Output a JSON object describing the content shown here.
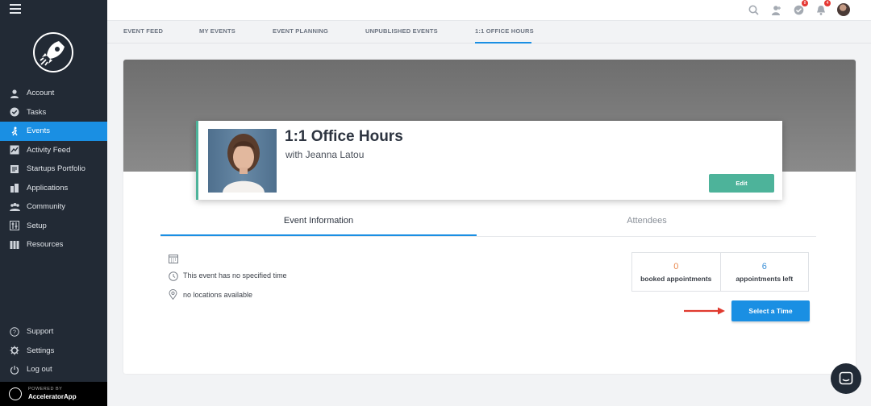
{
  "sidebar": {
    "items": [
      {
        "label": "Account",
        "icon": "user-icon"
      },
      {
        "label": "Tasks",
        "icon": "check-circle-icon"
      },
      {
        "label": "Events",
        "icon": "events-icon",
        "active": true
      },
      {
        "label": "Activity Feed",
        "icon": "activity-icon"
      },
      {
        "label": "Startups Portfolio",
        "icon": "portfolio-icon"
      },
      {
        "label": "Applications",
        "icon": "applications-icon"
      },
      {
        "label": "Community",
        "icon": "community-icon"
      },
      {
        "label": "Setup",
        "icon": "setup-icon"
      },
      {
        "label": "Resources",
        "icon": "resources-icon"
      }
    ],
    "bottom_items": [
      {
        "label": "Support",
        "icon": "help-icon"
      },
      {
        "label": "Settings",
        "icon": "gear-icon"
      },
      {
        "label": "Log out",
        "icon": "power-icon"
      }
    ],
    "powered_by": "POWERED BY",
    "brand": "AcceleratorApp"
  },
  "topbar": {
    "notification_badge_1": "8",
    "notification_badge_2": "4"
  },
  "subtabs": [
    {
      "label": "EVENT FEED"
    },
    {
      "label": "MY EVENTS"
    },
    {
      "label": "EVENT PLANNING"
    },
    {
      "label": "UNPUBLISHED EVENTS"
    },
    {
      "label": "1:1 OFFICE HOURS",
      "active": true
    }
  ],
  "event": {
    "title": "1:1 Office Hours",
    "host": "with Jeanna Latou",
    "edit_label": "Edit"
  },
  "tabs": {
    "info": "Event Information",
    "attendees": "Attendees"
  },
  "details": {
    "time": "This event has no specified time",
    "location": "no locations available"
  },
  "stats": {
    "booked_value": "0",
    "booked_label": "booked appointments",
    "left_value": "6",
    "left_label": "appointments left"
  },
  "select_time_label": "Select a Time",
  "colors": {
    "accent": "#1a8fe3",
    "edit_green": "#4db39a",
    "booked_orange": "#e9894f",
    "sidebar_bg": "#222a35"
  }
}
